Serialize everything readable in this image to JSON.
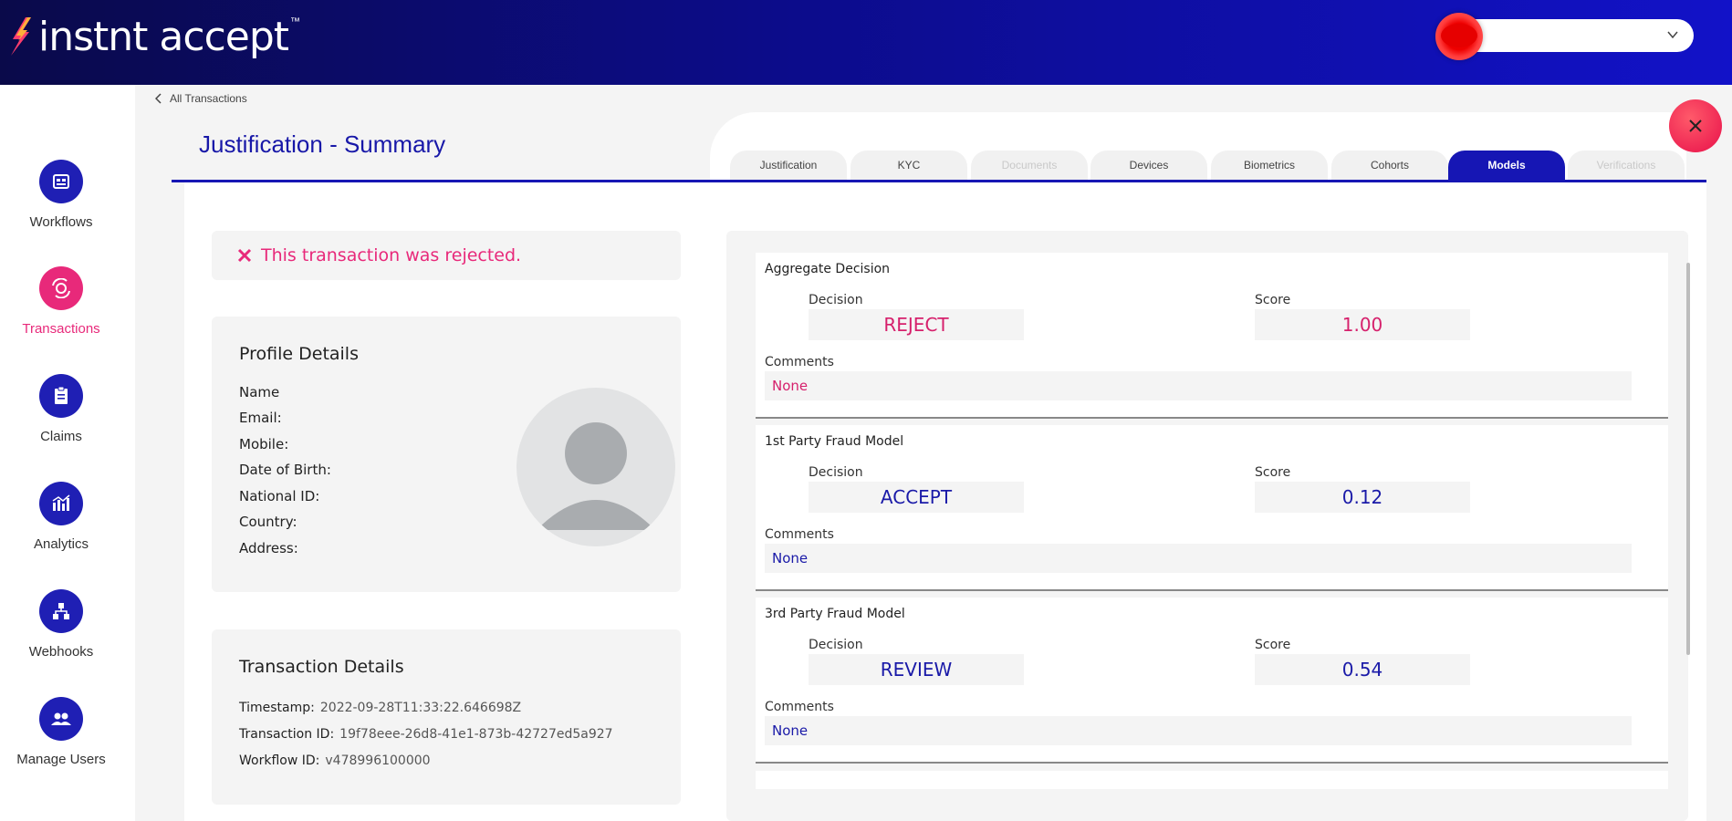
{
  "header": {
    "logo_text": "instnt accept",
    "logo_tm": "™"
  },
  "sidebar": {
    "items": [
      {
        "label": "Workflows",
        "icon": "workflows-icon",
        "active": false
      },
      {
        "label": "Transactions",
        "icon": "transactions-icon",
        "active": true
      },
      {
        "label": "Claims",
        "icon": "claims-icon",
        "active": false
      },
      {
        "label": "Analytics",
        "icon": "analytics-icon",
        "active": false
      },
      {
        "label": "Webhooks",
        "icon": "webhooks-icon",
        "active": false
      },
      {
        "label": "Manage Users",
        "icon": "manage-users-icon",
        "active": false
      }
    ]
  },
  "breadcrumb": "All Transactions",
  "page_title": "Justification - Summary",
  "tabs": [
    {
      "label": "Justification",
      "state": "normal"
    },
    {
      "label": "KYC",
      "state": "normal"
    },
    {
      "label": "Documents",
      "state": "disabled"
    },
    {
      "label": "Devices",
      "state": "normal"
    },
    {
      "label": "Biometrics",
      "state": "normal"
    },
    {
      "label": "Cohorts",
      "state": "normal"
    },
    {
      "label": "Models",
      "state": "active"
    },
    {
      "label": "Verifications",
      "state": "disabled"
    }
  ],
  "status_banner": "This transaction was rejected.",
  "profile": {
    "title": "Profile Details",
    "fields": [
      "Name",
      "Email:",
      "Mobile:",
      "Date of Birth:",
      "National ID:",
      "Country:",
      "Address:"
    ]
  },
  "transaction": {
    "title": "Transaction Details",
    "rows": [
      {
        "label": "Timestamp:",
        "value": "2022-09-28T11:33:22.646698Z"
      },
      {
        "label": "Transaction ID:",
        "value": "19f78eee-26d8-41e1-873b-42727ed5a927"
      },
      {
        "label": "Workflow ID:",
        "value": "v478996100000"
      }
    ]
  },
  "models": {
    "decision_label": "Decision",
    "score_label": "Score",
    "comments_label": "Comments",
    "items": [
      {
        "title": "Aggregate Decision",
        "decision": "REJECT",
        "score": "1.00",
        "comments": "None",
        "color": "#d6206c"
      },
      {
        "title": "1st Party Fraud Model",
        "decision": "ACCEPT",
        "score": "0.12",
        "comments": "None",
        "color": "#1a1aa8"
      },
      {
        "title": "3rd Party Fraud Model",
        "decision": "REVIEW",
        "score": "0.54",
        "comments": "None",
        "color": "#1a1aa8"
      }
    ]
  },
  "colors": {
    "accent_blue": "#1616b4",
    "accent_pink": "#e8297a"
  }
}
